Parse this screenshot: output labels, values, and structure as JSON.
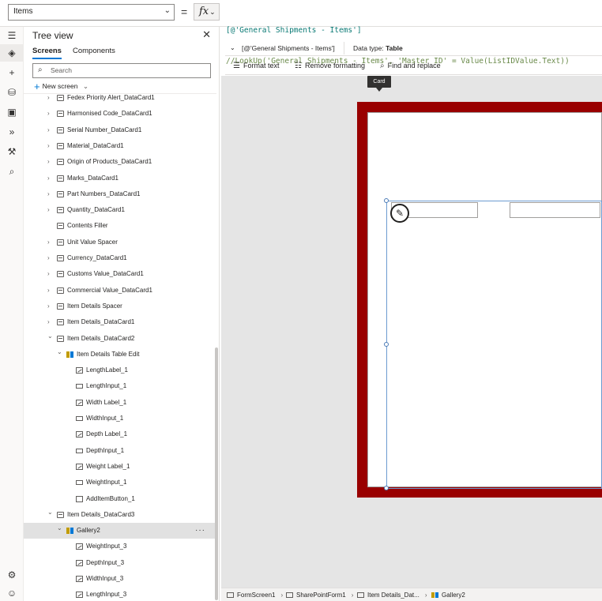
{
  "formula_bar": {
    "property": "Items",
    "equals": "=",
    "fx": "fx",
    "line1": "[@'General Shipments - Items']",
    "line2": "//LookUp('General Shipments - Items', 'Master ID' = Value(ListIDValue.Text))"
  },
  "tree": {
    "title": "Tree view",
    "tabs": [
      "Screens",
      "Components"
    ],
    "search_placeholder": "Search",
    "new_screen": "New screen",
    "items": [
      {
        "label": "Fedex Priority Alert_DataCard1",
        "icon": "card",
        "indent": 0,
        "chevron": "right"
      },
      {
        "label": "Harmonised Code_DataCard1",
        "icon": "card",
        "indent": 0,
        "chevron": "right"
      },
      {
        "label": "Serial Number_DataCard1",
        "icon": "card",
        "indent": 0,
        "chevron": "right"
      },
      {
        "label": "Material_DataCard1",
        "icon": "card",
        "indent": 0,
        "chevron": "right"
      },
      {
        "label": "Origin of Products_DataCard1",
        "icon": "card",
        "indent": 0,
        "chevron": "right"
      },
      {
        "label": "Marks_DataCard1",
        "icon": "card",
        "indent": 0,
        "chevron": "right"
      },
      {
        "label": "Part Numbers_DataCard1",
        "icon": "card",
        "indent": 0,
        "chevron": "right"
      },
      {
        "label": "Quantity_DataCard1",
        "icon": "card",
        "indent": 0,
        "chevron": "right"
      },
      {
        "label": "Contents Filler",
        "icon": "card",
        "indent": 0,
        "chevron": ""
      },
      {
        "label": "Unit Value Spacer",
        "icon": "card",
        "indent": 0,
        "chevron": "right"
      },
      {
        "label": "Currency_DataCard1",
        "icon": "card",
        "indent": 0,
        "chevron": "right"
      },
      {
        "label": "Customs Value_DataCard1",
        "icon": "card",
        "indent": 0,
        "chevron": "right"
      },
      {
        "label": "Commercial Value_DataCard1",
        "icon": "card",
        "indent": 0,
        "chevron": "right"
      },
      {
        "label": "Item Details Spacer",
        "icon": "card",
        "indent": 0,
        "chevron": "right"
      },
      {
        "label": "Item Details_DataCard1",
        "icon": "card",
        "indent": 0,
        "chevron": "right"
      },
      {
        "label": "Item Details_DataCard2",
        "icon": "card",
        "indent": 0,
        "chevron": "down"
      },
      {
        "label": "Item Details Table Edit",
        "icon": "gallery",
        "indent": 1,
        "chevron": "down"
      },
      {
        "label": "LengthLabel_1",
        "icon": "label",
        "indent": 2,
        "chevron": ""
      },
      {
        "label": "LengthInput_1",
        "icon": "input",
        "indent": 2,
        "chevron": ""
      },
      {
        "label": "Width Label_1",
        "icon": "label",
        "indent": 2,
        "chevron": ""
      },
      {
        "label": "WidthInput_1",
        "icon": "input",
        "indent": 2,
        "chevron": ""
      },
      {
        "label": "Depth Label_1",
        "icon": "label",
        "indent": 2,
        "chevron": ""
      },
      {
        "label": "DepthInput_1",
        "icon": "input",
        "indent": 2,
        "chevron": ""
      },
      {
        "label": "Weight Label_1",
        "icon": "label",
        "indent": 2,
        "chevron": ""
      },
      {
        "label": "WeightInput_1",
        "icon": "input",
        "indent": 2,
        "chevron": ""
      },
      {
        "label": "AddItemButton_1",
        "icon": "button",
        "indent": 2,
        "chevron": ""
      },
      {
        "label": "Item Details_DataCard3",
        "icon": "card",
        "indent": 0,
        "chevron": "down"
      },
      {
        "label": "Gallery2",
        "icon": "gallery",
        "indent": 1,
        "chevron": "down",
        "selected": true
      },
      {
        "label": "WeightInput_3",
        "icon": "label",
        "indent": 2,
        "chevron": ""
      },
      {
        "label": "DepthInput_3",
        "icon": "label",
        "indent": 2,
        "chevron": ""
      },
      {
        "label": "WidthInput_3",
        "icon": "label",
        "indent": 2,
        "chevron": ""
      },
      {
        "label": "LengthInput_3",
        "icon": "label",
        "indent": 2,
        "chevron": ""
      }
    ],
    "more": "···"
  },
  "toolbar": {
    "source": "[@'General Shipments - Items']",
    "data_type_label": "Data type:",
    "data_type_value": "Table",
    "format_text": "Format text",
    "remove_formatting": "Remove formatting",
    "find_replace": "Find and replace"
  },
  "canvas": {
    "tooltip": "Card"
  },
  "breadcrumbs": [
    "FormScreen1",
    "SharePointForm1",
    "Item Details_Dat...",
    "Gallery2"
  ]
}
